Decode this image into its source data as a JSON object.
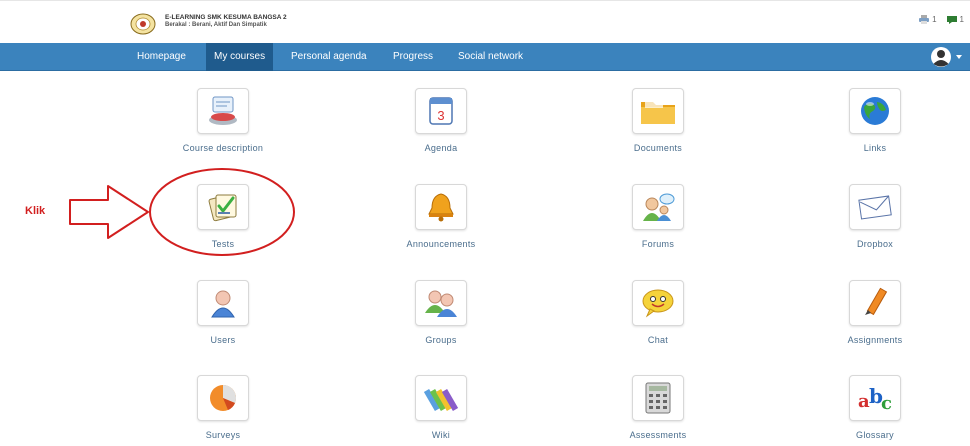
{
  "header": {
    "site_name": "E-LEARNING SMK KESUMA BANGSA 2",
    "tagline": "Berakal : Berani, Aktif Dan Simpatik",
    "notifications_count": "1",
    "messages_count": "1"
  },
  "nav": {
    "items": [
      {
        "label": "Homepage"
      },
      {
        "label": "My courses"
      },
      {
        "label": "Personal agenda"
      },
      {
        "label": "Progress"
      },
      {
        "label": "Social network"
      }
    ],
    "active": "My courses"
  },
  "tools": [
    {
      "label": "Course description",
      "icon": "course-description-icon"
    },
    {
      "label": "Agenda",
      "icon": "calendar-icon"
    },
    {
      "label": "Documents",
      "icon": "folder-icon"
    },
    {
      "label": "Links",
      "icon": "globe-icon"
    },
    {
      "label": "Tests",
      "icon": "test-checklist-icon"
    },
    {
      "label": "Announcements",
      "icon": "bell-icon"
    },
    {
      "label": "Forums",
      "icon": "forum-icon"
    },
    {
      "label": "Dropbox",
      "icon": "envelope-icon"
    },
    {
      "label": "Users",
      "icon": "user-icon"
    },
    {
      "label": "Groups",
      "icon": "group-icon"
    },
    {
      "label": "Chat",
      "icon": "chat-icon"
    },
    {
      "label": "Assignments",
      "icon": "pencil-icon"
    },
    {
      "label": "Surveys",
      "icon": "pie-chart-icon"
    },
    {
      "label": "Wiki",
      "icon": "books-icon"
    },
    {
      "label": "Assessments",
      "icon": "calculator-icon"
    },
    {
      "label": "Glossary",
      "icon": "abc-icon"
    }
  ],
  "annotation": {
    "label": "Klik",
    "color": "#d21f1f"
  },
  "colors": {
    "navbar": "#3b83bd",
    "nav_active": "#1f5b8d",
    "tool_label": "#4a6d8c"
  }
}
